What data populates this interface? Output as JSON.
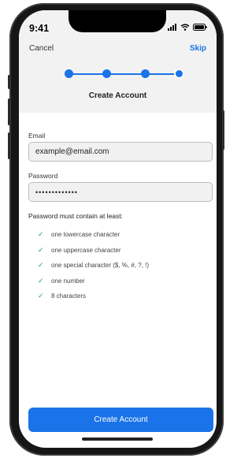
{
  "status_bar": {
    "time": "9:41",
    "icons": [
      "cellular-signal-icon",
      "wifi-icon",
      "battery-icon"
    ]
  },
  "nav": {
    "cancel_label": "Cancel",
    "skip_label": "Skip"
  },
  "stepper": {
    "total_steps": 4,
    "current_step": 4
  },
  "title": "Create Account",
  "form": {
    "email_label": "Email",
    "email_value": "example@email.com",
    "password_label": "Password",
    "password_value": "•••••••••••••"
  },
  "requirements": {
    "heading": "Password must contain at least:",
    "items": [
      "one lowercase character",
      "one uppercase character",
      "one special character ($, %, #, ?, !)",
      "one number",
      "8 characters"
    ]
  },
  "cta_label": "Create Account",
  "colors": {
    "accent": "#1a73e8",
    "check": "#2e9e5b",
    "header_bg": "#f2f2f2"
  }
}
